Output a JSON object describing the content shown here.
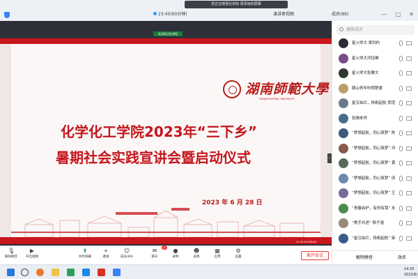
{
  "topbar": {
    "sharing_banner": "您正在观看社实际 周青哒的屏幕",
    "timer": "23:45(60分钟)",
    "speaker_view": "演讲者视图",
    "members_label": "成员(89)",
    "win_controls": [
      "—",
      "□",
      "✕"
    ]
  },
  "stage": {
    "share_tag": "社实际正在讲话",
    "slide": {
      "logo_cn": "湖南師範大學",
      "logo_en": "HUNAN NORMAL UNIVERSITY",
      "title_line1": "化学化工学院2023年“三下乡”",
      "title_line2": "暑期社会实践宣讲会暨启动仪式",
      "date": "2023 年 6 月 28 日",
      "meta": "14:30 2023/6/28"
    }
  },
  "panel": {
    "search_placeholder": "搜索成员",
    "members": [
      {
        "name": "星火师大 梁剑约",
        "color": "#2b2b35"
      },
      {
        "name": "星火师大邓钰琳",
        "color": "#7a4d8c"
      },
      {
        "name": "星火师大张雅文",
        "color": "#2e3a2e"
      },
      {
        "name": "颇山青年吹明楚睿",
        "color": "#b8a06a"
      },
      {
        "name": "星汉灿烂，扬帆起航 贺瑄",
        "color": "#6b7a8f"
      },
      {
        "name": "张婧老师",
        "color": "#4a6a8a"
      },
      {
        "name": "“梦想起航，同心筑梦” 陈曦",
        "color": "#3c5a7a"
      },
      {
        "name": "“梦想起航，同心筑梦” 邓航徊",
        "color": "#8a5a4a"
      },
      {
        "name": "“梦想起航，同心筑梦” 黄佳敏",
        "color": "#5a6a5a"
      },
      {
        "name": "“梦想起航，同心筑梦” 田佳思",
        "color": "#6a8ab0"
      },
      {
        "name": "“梦想起航，同心筑梦” 王荧",
        "color": "#7a6a9a"
      },
      {
        "name": "“青春启护，有你有我” 米婷惜",
        "color": "#4a8a4a"
      },
      {
        "name": "“携手共进” 郁子涵",
        "color": "#9a8a7a"
      },
      {
        "name": "“星汉灿烂，扬帆起航” 柴晗",
        "color": "#3a5a8a"
      }
    ],
    "mute_all": "解除静音",
    "rename": "改名"
  },
  "toolbar": {
    "tools": [
      {
        "label": "解除静音",
        "icon": "microphone-icon"
      },
      {
        "label": "开启视频",
        "icon": "camera-icon"
      },
      {
        "label": "共享屏幕",
        "icon": "share-screen-icon"
      },
      {
        "label": "邀请",
        "icon": "invite-icon"
      },
      {
        "label": "成员(89)",
        "icon": "members-icon"
      },
      {
        "label": "聊天",
        "icon": "chat-icon"
      },
      {
        "label": "录制",
        "icon": "record-icon"
      },
      {
        "label": "表情",
        "icon": "reaction-icon"
      },
      {
        "label": "应用",
        "icon": "apps-icon"
      },
      {
        "label": "设置",
        "icon": "settings-icon"
      }
    ],
    "chat_badge": "1",
    "end_meeting": "离开会议"
  },
  "taskbar": {
    "time": "14:30",
    "date": "2023/6/"
  }
}
